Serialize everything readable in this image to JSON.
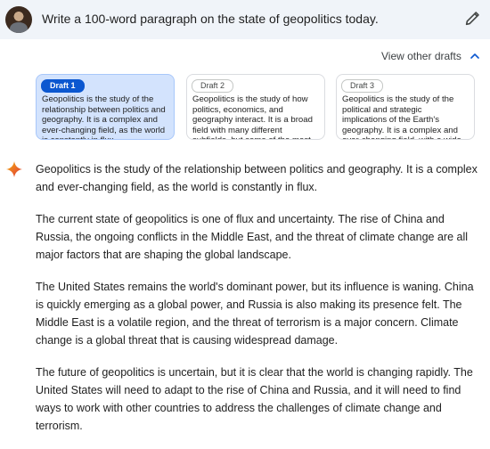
{
  "prompt": {
    "text": "Write a 100-word paragraph on the state of geopolitics today.",
    "avatar_icon": "user-avatar",
    "edit_icon": "pencil-icon"
  },
  "drafts_toggle": {
    "label": "View other drafts",
    "icon": "chevron-up-icon"
  },
  "drafts": [
    {
      "label": "Draft 1",
      "selected": true,
      "preview": "Geopolitics is the study of the relationship between politics and geography. It is a complex and ever-changing field, as the world is constantly in flux."
    },
    {
      "label": "Draft 2",
      "selected": false,
      "preview": "Geopolitics is the study of how politics, economics, and geography interact. It is a broad field with many different subfields, but some of the most important geopolitical issues"
    },
    {
      "label": "Draft 3",
      "selected": false,
      "preview": "Geopolitics is the study of the political and strategic implications of the Earth's geography. It is a complex and ever-changing field, with a wide range of factors shaping"
    }
  ],
  "response": {
    "icon": "gemini-sparkle-icon",
    "paragraphs": [
      "Geopolitics is the study of the relationship between politics and geography. It is a complex and ever-changing field, as the world is constantly in flux.",
      "The current state of geopolitics is one of flux and uncertainty. The rise of China and Russia, the ongoing conflicts in the Middle East, and the threat of climate change are all major factors that are shaping the global landscape.",
      "The United States remains the world's dominant power, but its influence is waning. China is quickly emerging as a global power, and Russia is also making its presence felt. The Middle East is a volatile region, and the threat of terrorism is a major concern. Climate change is a global threat that is causing widespread damage.",
      "The future of geopolitics is uncertain, but it is clear that the world is changing rapidly. The United States will need to adapt to the rise of China and Russia, and it will need to find ways to work with other countries to address the challenges of climate change and terrorism."
    ]
  },
  "colors": {
    "prompt_bg": "#f0f4f9",
    "active_draft_bg": "#d3e3fd",
    "active_chip": "#0b57d0"
  }
}
